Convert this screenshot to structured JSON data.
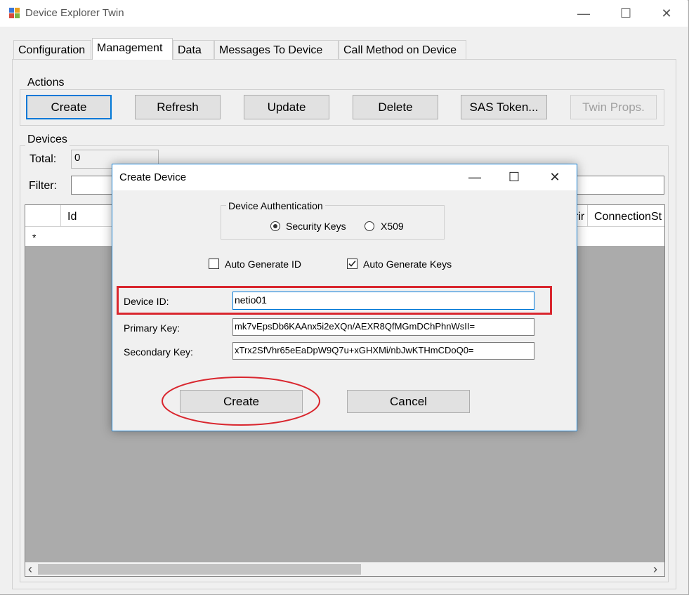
{
  "window": {
    "title": "Device Explorer Twin",
    "controls": {
      "minimize": "—",
      "maximize": "☐",
      "close": "✕"
    }
  },
  "tabs": [
    {
      "label": "Configuration"
    },
    {
      "label": "Management",
      "active": true
    },
    {
      "label": "Data"
    },
    {
      "label": "Messages To Device"
    },
    {
      "label": "Call Method on Device"
    }
  ],
  "actions": {
    "group_label": "Actions",
    "buttons": {
      "create": "Create",
      "refresh": "Refresh",
      "update": "Update",
      "delete": "Delete",
      "sas_token": "SAS Token...",
      "twin_props": "Twin Props."
    }
  },
  "devices": {
    "group_label": "Devices",
    "total_label": "Total:",
    "total_value": "0",
    "filter_label": "Filter:",
    "filter_value": "",
    "columns": {
      "id": "Id",
      "partial": "rir",
      "connection_state": "ConnectionSt"
    },
    "new_row_marker": "*"
  },
  "dialog": {
    "title": "Create Device",
    "controls": {
      "minimize": "—",
      "maximize": "☐",
      "close": "✕"
    },
    "auth_group_label": "Device Authentication",
    "auth_options": {
      "security_keys": "Security Keys",
      "x509": "X509"
    },
    "auto_generate_id": {
      "label": "Auto Generate ID",
      "checked": false
    },
    "auto_generate_keys": {
      "label": "Auto Generate Keys",
      "checked": true
    },
    "device_id_label": "Device ID:",
    "device_id_value": "netio01",
    "primary_key_label": "Primary Key:",
    "primary_key_value": "mk7vEpsDb6KAAnx5i2eXQn/AEXR8QfMGmDChPhnWsII=",
    "secondary_key_label": "Secondary Key:",
    "secondary_key_value": "xTrx2SfVhr65eEaDpW9Q7u+xGHXMi/nbJwKTHmCDoQ0=",
    "create_button": "Create",
    "cancel_button": "Cancel"
  },
  "annotations": {
    "color": "#d9262e"
  },
  "scrollbar": {
    "left_arrow": "‹",
    "right_arrow": "›"
  }
}
